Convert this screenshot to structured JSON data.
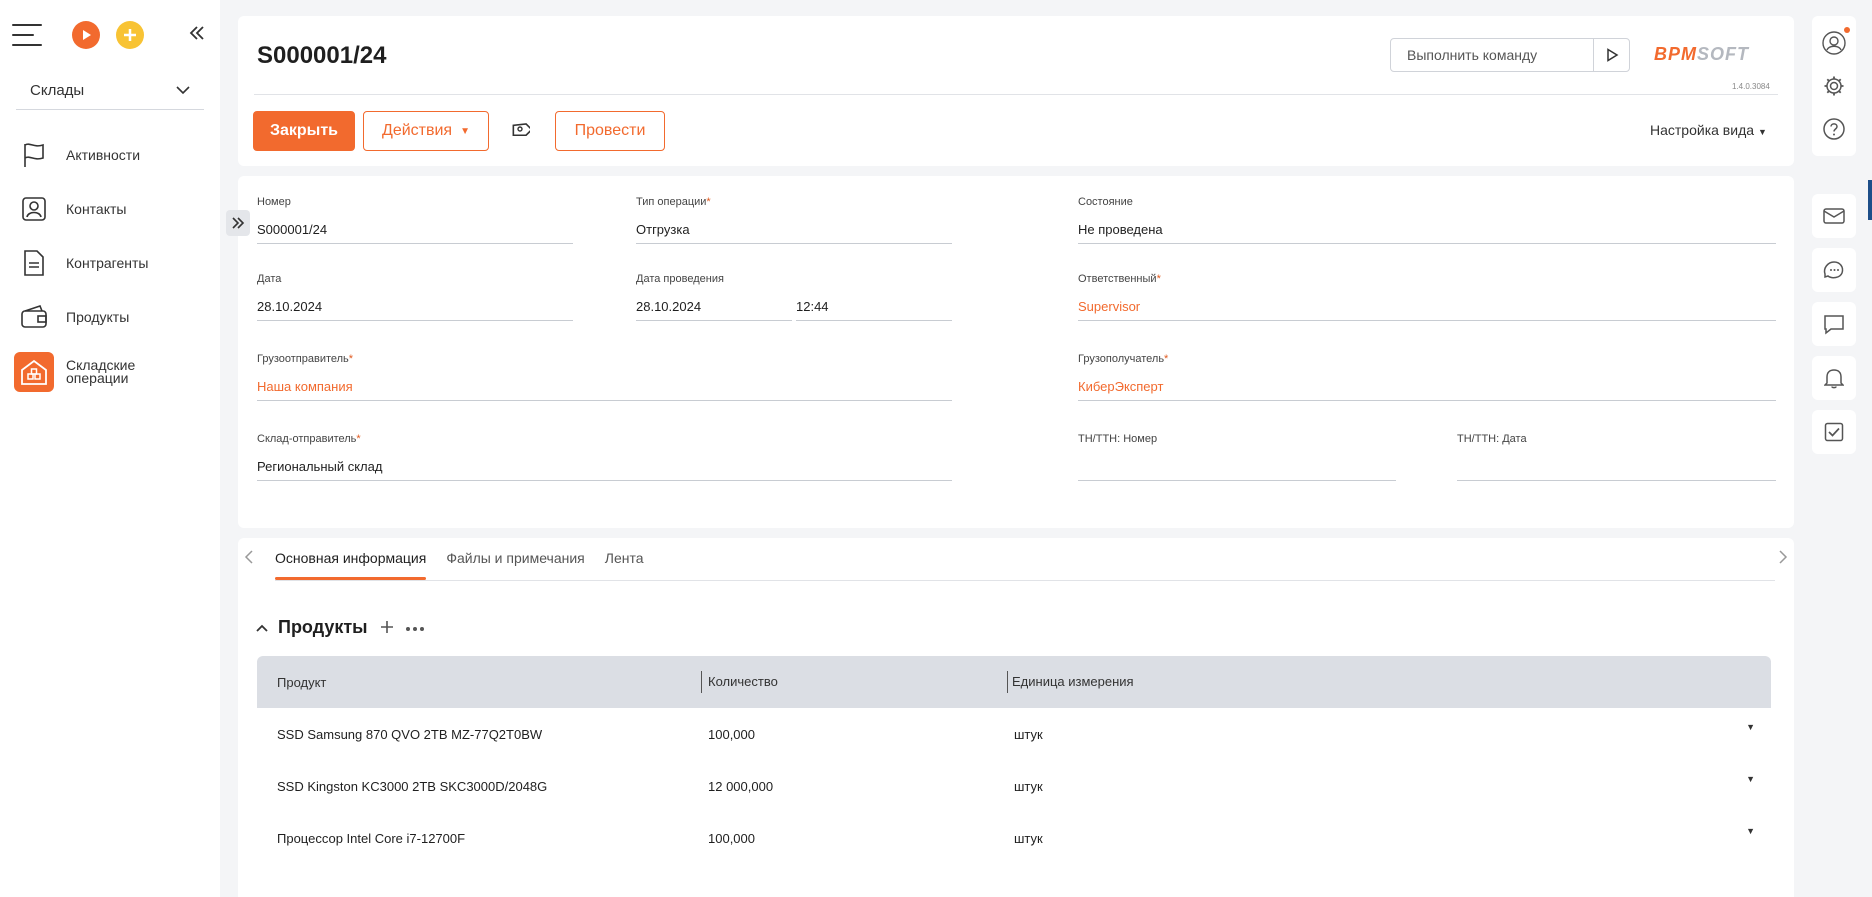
{
  "sidebar": {
    "workspace": "Склады",
    "items": [
      {
        "label": "Активности",
        "icon": "flag-icon"
      },
      {
        "label": "Контакты",
        "icon": "contact-icon"
      },
      {
        "label": "Контрагенты",
        "icon": "document-icon"
      },
      {
        "label": "Продукты",
        "icon": "wallet-icon"
      },
      {
        "label": "Складские операции",
        "icon": "warehouse-icon",
        "active": true
      }
    ]
  },
  "header": {
    "title": "S000001/24",
    "command_placeholder": "Выполнить команду",
    "logo_bpm": "BPM",
    "logo_soft": "SOFT",
    "version": "1.4.0.3084",
    "close_label": "Закрыть",
    "actions_label": "Действия",
    "post_label": "Провести",
    "view_settings_label": "Настройка вида"
  },
  "fields": {
    "number": {
      "label": "Номер",
      "value": "S000001/24"
    },
    "op_type": {
      "label": "Тип операции",
      "value": "Отгрузка"
    },
    "state": {
      "label": "Состояние",
      "value": "Не проведена"
    },
    "date": {
      "label": "Дата",
      "value": "28.10.2024"
    },
    "post_date": {
      "label": "Дата проведения",
      "value": "28.10.2024",
      "time": "12:44"
    },
    "responsible": {
      "label": "Ответственный",
      "value": "Supervisor"
    },
    "shipper": {
      "label": "Грузоотправитель",
      "value": "Наша компания"
    },
    "consignee": {
      "label": "Грузополучатель",
      "value": "КиберЭксперт"
    },
    "warehouse": {
      "label": "Склад-отправитель",
      "value": "Региональный склад"
    },
    "ttn_number": {
      "label": "ТН/ТТН: Номер",
      "value": ""
    },
    "ttn_date": {
      "label": "ТН/ТТН: Дата",
      "value": ""
    }
  },
  "tabs": [
    {
      "label": "Основная информация",
      "active": true
    },
    {
      "label": "Файлы и примечания"
    },
    {
      "label": "Лента"
    }
  ],
  "products": {
    "title": "Продукты",
    "columns": [
      "Продукт",
      "Количество",
      "Единица измерения"
    ],
    "rows": [
      [
        "SSD Samsung 870 QVO 2TB MZ-77Q2T0BW",
        "100,000",
        "штук"
      ],
      [
        "SSD Kingston KC3000 2TB SKC3000D/2048G",
        "12 000,000",
        "штук"
      ],
      [
        "Процессор Intel Core i7-12700F",
        "100,000",
        "штук"
      ]
    ]
  },
  "colors": {
    "accent": "#f26a2e",
    "plus": "#f8c334"
  }
}
